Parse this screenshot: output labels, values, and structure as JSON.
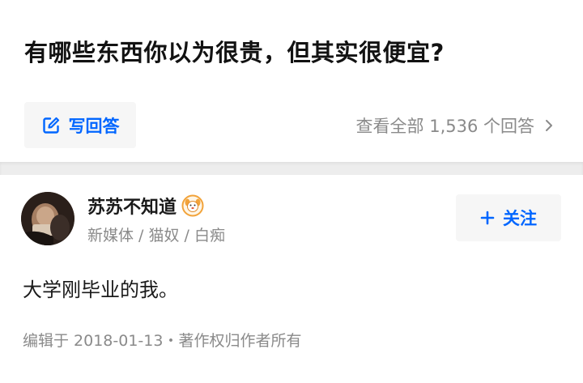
{
  "question": {
    "title": "有哪些东西你以为很贵，但其实很便宜?",
    "write_answer_label": "写回答",
    "view_all_label": "查看全部 1,536 个回答"
  },
  "answer": {
    "author_name": "苏苏不知道",
    "author_headline": "新媒体 / 猫奴 / 白痴",
    "follow_label": "关注",
    "content": "大学刚毕业的我。",
    "meta": "编辑于 2018-01-13・著作权归作者所有"
  },
  "icons": {
    "write": "edit-square-icon",
    "chevron": "chevron-right-icon",
    "plus": "plus-icon",
    "badge": "dog-badge-icon"
  },
  "colors": {
    "accent": "#0066ff",
    "secondary_text": "#8a8a8a",
    "button_bg": "#f6f6f6",
    "divider": "#ededed"
  }
}
